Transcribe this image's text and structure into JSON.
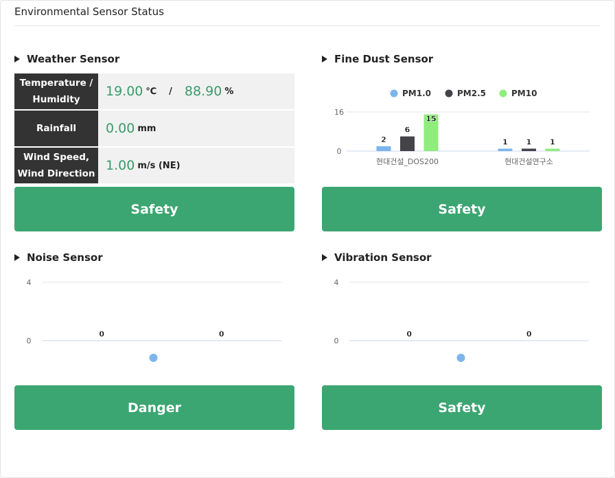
{
  "title": "Environmental Sensor Status",
  "weather": {
    "heading": "Weather Sensor",
    "rows": [
      {
        "label": "Temperature / Humidity",
        "value1": "19.00",
        "unit1": "℃",
        "sep": "/",
        "value2": "88.90",
        "unit2": "%"
      },
      {
        "label": "Rainfall",
        "value1": "0.00",
        "unit1": "mm"
      },
      {
        "label": "Wind Speed, Wind Direction",
        "value1": "1.00",
        "unit1": "m/s (NE)"
      }
    ],
    "status": "Safety"
  },
  "dust": {
    "heading": "Fine Dust Sensor",
    "status": "Safety"
  },
  "noise": {
    "heading": "Noise Sensor",
    "status": "Danger"
  },
  "vibration": {
    "heading": "Vibration Sensor",
    "status": "Safety"
  },
  "colors": {
    "safe": "#3ba672",
    "pm1": "#7cb5ec",
    "pm25": "#434348",
    "pm10": "#90ed7d",
    "value": "#3a9a6a"
  },
  "chart_data": [
    {
      "type": "bar",
      "id": "dust",
      "categories": [
        "현대건설_DOS200",
        "현대건설연구소"
      ],
      "series": [
        {
          "name": "PM1.0",
          "values": [
            2,
            1
          ],
          "color": "#7cb5ec"
        },
        {
          "name": "PM2.5",
          "values": [
            6,
            1
          ],
          "color": "#434348"
        },
        {
          "name": "PM10",
          "values": [
            15,
            1
          ],
          "color": "#90ed7d"
        }
      ],
      "yticks": [
        0,
        16
      ],
      "ylim": [
        0,
        16
      ],
      "legend": "top",
      "grid": true
    },
    {
      "type": "bar",
      "id": "noise",
      "categories": [
        "",
        ""
      ],
      "series": [
        {
          "values": [
            0,
            0
          ],
          "color": "#7cb5ec"
        }
      ],
      "yticks": [
        0,
        4
      ],
      "ylim": [
        0,
        4
      ],
      "legend": "bottom",
      "grid": true
    },
    {
      "type": "bar",
      "id": "vibration",
      "categories": [
        "",
        ""
      ],
      "series": [
        {
          "values": [
            0,
            0
          ],
          "color": "#7cb5ec"
        }
      ],
      "yticks": [
        0,
        4
      ],
      "ylim": [
        0,
        4
      ],
      "legend": "bottom",
      "grid": true
    }
  ]
}
